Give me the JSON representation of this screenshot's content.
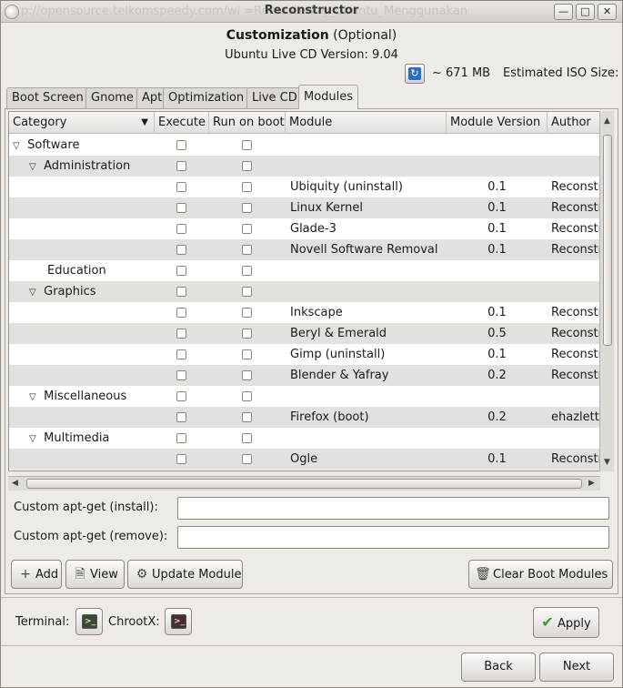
{
  "window": {
    "title": "Reconstructor",
    "background_title": "p://opensource.telkomspeedy.com/wi                    =Remastering_Ubuntu_Menggunakan"
  },
  "header": {
    "heading": "Customization",
    "heading_suffix": "(Optional)",
    "version_text": "Ubuntu Live CD Version: 9.04",
    "size_text": "~ 671 MB",
    "iso_size_label": "Estimated ISO Size:"
  },
  "tabs": [
    "Boot Screen",
    "Gnome",
    "Apt",
    "Optimization",
    "Live CD",
    "Modules"
  ],
  "active_tab": "Modules",
  "tree": {
    "columns": [
      "Category",
      "Execute",
      "Run on boot",
      "Module",
      "Module Version",
      "Author"
    ],
    "rows": [
      {
        "category": "Software",
        "level": 0,
        "expander": true,
        "module": "",
        "version": "",
        "author": ""
      },
      {
        "category": "Administration",
        "level": 1,
        "expander": true,
        "module": "",
        "version": "",
        "author": ""
      },
      {
        "category": "",
        "level": 2,
        "expander": false,
        "module": "Ubiquity (uninstall)",
        "version": "0.1",
        "author": "Reconstr"
      },
      {
        "category": "",
        "level": 2,
        "expander": false,
        "module": "Linux Kernel",
        "version": "0.1",
        "author": "Reconstr"
      },
      {
        "category": "",
        "level": 2,
        "expander": false,
        "module": "Glade-3",
        "version": "0.1",
        "author": "Reconstr"
      },
      {
        "category": "",
        "level": 2,
        "expander": false,
        "module": "Novell Software Removal",
        "version": "0.1",
        "author": "Reconstr"
      },
      {
        "category": "Education",
        "level": 1,
        "expander": false,
        "module": "",
        "version": "",
        "author": ""
      },
      {
        "category": "Graphics",
        "level": 1,
        "expander": true,
        "module": "",
        "version": "",
        "author": ""
      },
      {
        "category": "",
        "level": 2,
        "expander": false,
        "module": "Inkscape",
        "version": "0.1",
        "author": "Reconstr"
      },
      {
        "category": "",
        "level": 2,
        "expander": false,
        "module": "Beryl & Emerald",
        "version": "0.5",
        "author": "Reconstr"
      },
      {
        "category": "",
        "level": 2,
        "expander": false,
        "module": "Gimp (uninstall)",
        "version": "0.1",
        "author": "Reconstr"
      },
      {
        "category": "",
        "level": 2,
        "expander": false,
        "module": "Blender & Yafray",
        "version": "0.2",
        "author": "Reconstr"
      },
      {
        "category": "Miscellaneous",
        "level": 1,
        "expander": true,
        "module": "",
        "version": "",
        "author": ""
      },
      {
        "category": "",
        "level": 2,
        "expander": false,
        "module": "Firefox (boot)",
        "version": "0.2",
        "author": "ehazlett"
      },
      {
        "category": "Multimedia",
        "level": 1,
        "expander": true,
        "module": "",
        "version": "",
        "author": ""
      },
      {
        "category": "",
        "level": 2,
        "expander": false,
        "module": "Ogle",
        "version": "0.1",
        "author": "Reconstr"
      }
    ]
  },
  "fields": {
    "install_label": "Custom apt-get (install):",
    "install_value": "",
    "remove_label": "Custom apt-get (remove):",
    "remove_value": ""
  },
  "buttons": {
    "add": "Add",
    "view": "View",
    "update_module": "Update Module",
    "clear_boot_modules": "Clear Boot Modules",
    "apply": "Apply",
    "back": "Back",
    "next": "Next"
  },
  "footer": {
    "terminal_label": "Terminal:",
    "chrootx_label": "ChrootX:"
  }
}
